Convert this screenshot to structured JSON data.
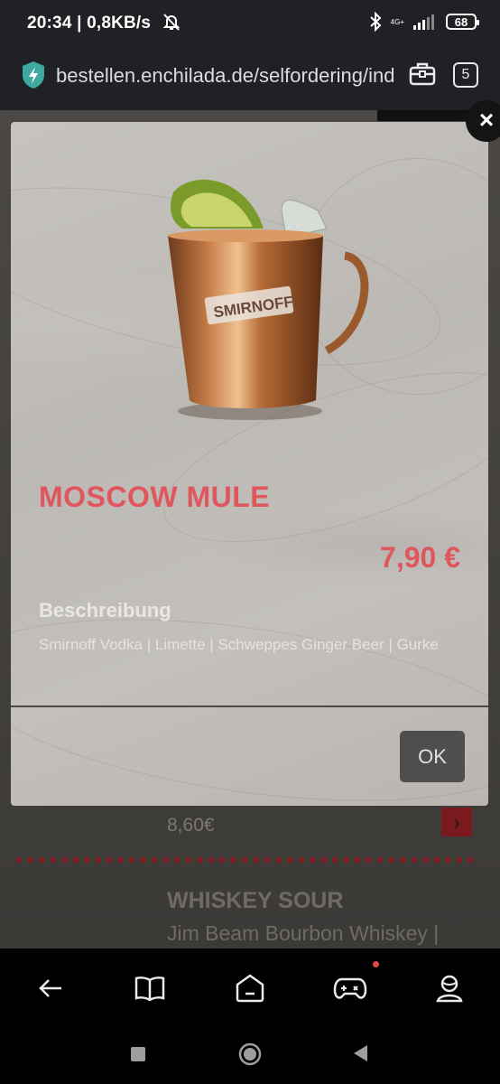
{
  "status_bar": {
    "time_and_speed": "20:34 | 0,8KB/s",
    "network_type": "4G+",
    "battery": "68"
  },
  "browser": {
    "url": "bestellen.enchilada.de/selfordering/ind",
    "tab_count": "5"
  },
  "background": {
    "price": "8,60€",
    "next_title": "WHISKEY SOUR",
    "next_desc": "Jim Beam Bourbon Whiskey |"
  },
  "modal": {
    "title": "MOSCOW MULE",
    "price": "7,90 €",
    "description_heading": "Beschreibung",
    "description": "Smirnoff Vodka | Limette | Schweppes Ginger Beer | Gurke",
    "ok_label": "OK",
    "close_label": "×",
    "image_brand": "SMIRNOFF"
  },
  "bottom_nav": {
    "items": [
      "back-icon",
      "book-icon",
      "home-icon",
      "gamepad-icon",
      "profile-icon"
    ]
  },
  "colors": {
    "accent": "#e0565c",
    "dots": "#7e1c21"
  }
}
